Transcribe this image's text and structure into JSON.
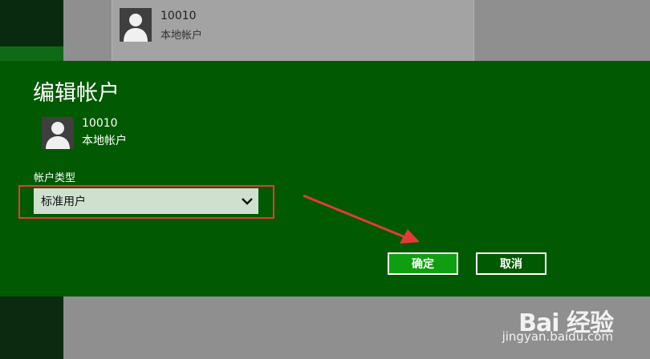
{
  "background": {
    "account": {
      "name": "10010",
      "type": "本地帐户"
    }
  },
  "dialog": {
    "title": "编辑帐户",
    "account": {
      "name": "10010",
      "type": "本地帐户"
    },
    "field_label": "帐户类型",
    "select_value": "标准用户",
    "ok_label": "确定",
    "cancel_label": "取消"
  },
  "watermark": {
    "logo": "Bai 经验",
    "url": "jingyan.baidu.com"
  },
  "icons": {
    "avatar": "user-silhouette-icon",
    "dropdown": "chevron-down-icon"
  },
  "colors": {
    "dialog_bg": "#015a01",
    "ok_button": "#0f9e10",
    "highlight": "#e23a3a",
    "select_bg": "#cfe0cf"
  }
}
